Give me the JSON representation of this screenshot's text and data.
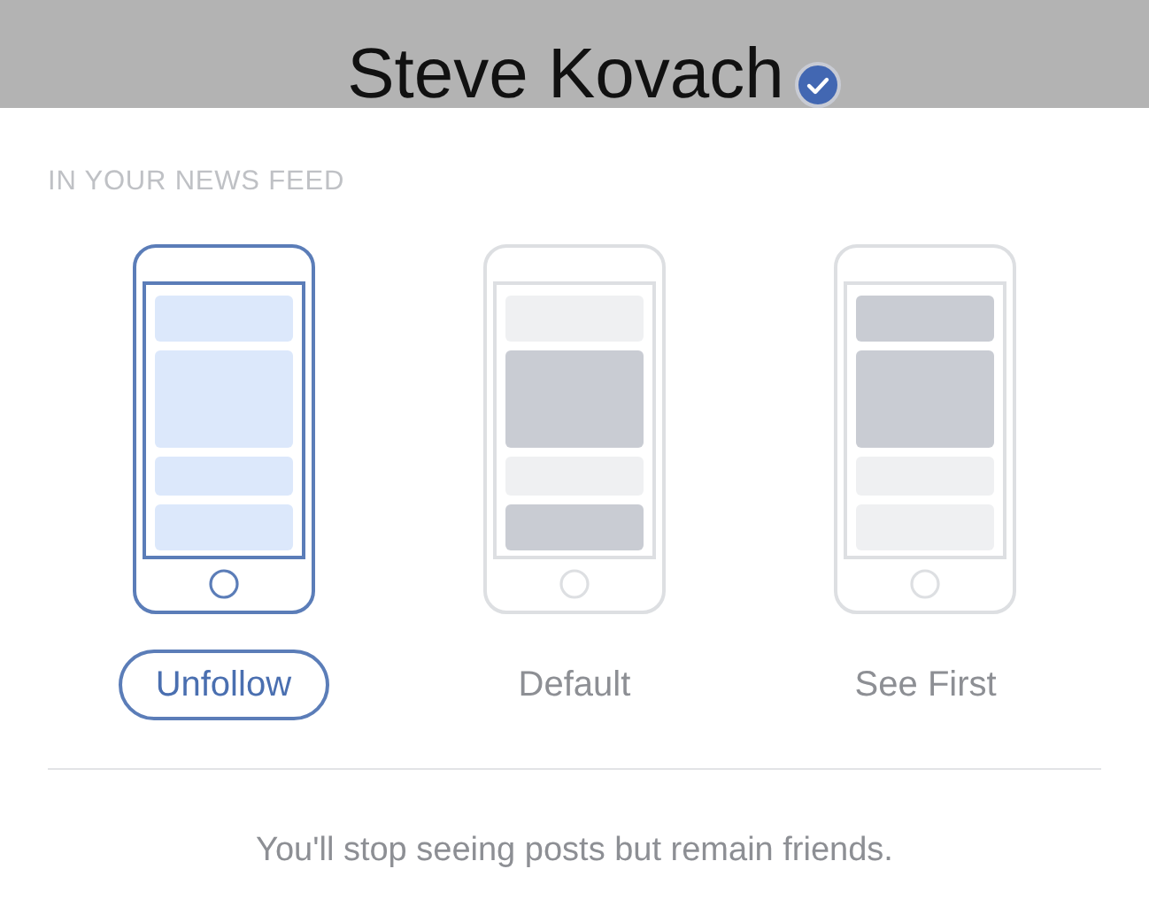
{
  "header": {
    "name": "Steve Kovach",
    "verified": true
  },
  "section": {
    "title": "IN YOUR NEWS FEED"
  },
  "options": [
    {
      "label": "Unfollow",
      "selected": true,
      "cards": [
        {
          "shaded": false
        },
        {
          "shaded": false
        },
        {
          "shaded": false
        },
        {
          "shaded": false
        }
      ]
    },
    {
      "label": "Default",
      "selected": false,
      "cards": [
        {
          "shaded": false
        },
        {
          "shaded": true
        },
        {
          "shaded": false
        },
        {
          "shaded": true
        }
      ]
    },
    {
      "label": "See First",
      "selected": false,
      "cards": [
        {
          "shaded": true
        },
        {
          "shaded": true
        },
        {
          "shaded": false
        },
        {
          "shaded": false
        }
      ]
    }
  ],
  "description": "You'll stop seeing posts but remain friends."
}
